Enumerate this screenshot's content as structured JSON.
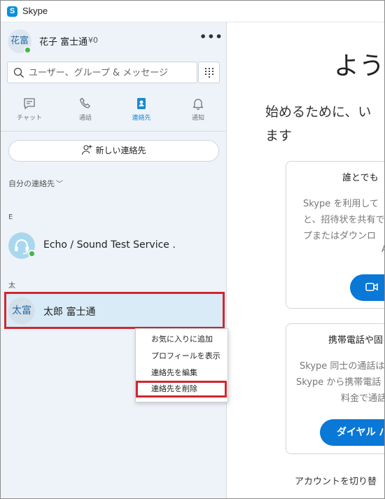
{
  "window": {
    "title": "Skype",
    "logo_letter": "S"
  },
  "profile": {
    "avatar_text": "花富",
    "name": "花子 富士通",
    "credit": "¥0",
    "more_label": "•••"
  },
  "search": {
    "placeholder": "ユーザー、グループ & メッセージ"
  },
  "tabs": [
    {
      "label": "チャット",
      "icon": "chat-icon",
      "active": false
    },
    {
      "label": "通話",
      "icon": "phone-icon",
      "active": false
    },
    {
      "label": "連絡先",
      "icon": "contacts-icon",
      "active": true
    },
    {
      "label": "通知",
      "icon": "bell-icon",
      "active": false
    }
  ],
  "new_contact_label": "新しい連絡先",
  "filter_label": "自分の連絡先",
  "sections": [
    {
      "letter": "E",
      "contacts": [
        {
          "name": "Echo / Sound Test Service .",
          "avatar": "headset-icon"
        }
      ]
    },
    {
      "letter": "太",
      "contacts": [
        {
          "name": "太郎 富士通",
          "avatar_text": "太富",
          "selected": true
        }
      ]
    }
  ],
  "context_menu": {
    "items": [
      {
        "label": "お気に入りに追加"
      },
      {
        "label": "プロフィールを表示"
      },
      {
        "label": "連絡先を編集"
      },
      {
        "label": "連絡先を削除",
        "highlighted": true
      }
    ]
  },
  "main": {
    "title": "よう",
    "subtitle_line1": "始めるために、い",
    "subtitle_line2": "ます",
    "card1": {
      "title": "誰とでも",
      "lines": [
        "Skype を利用して",
        "と、招待状を共有で",
        "プまたはダウンロ",
        "A"
      ]
    },
    "card2": {
      "title": "携帯電話や固",
      "lines": [
        "Skype 同士の通話は",
        "Skype から携帯電話",
        "料金で通話"
      ],
      "button_label": "ダイヤル パ"
    },
    "switch_account_label": "アカウントを切り替"
  },
  "colors": {
    "accent": "#0a78d7",
    "presence": "#43b649",
    "sidebar_bg": "#eef3f9",
    "annotation_red": "#d1272f"
  }
}
